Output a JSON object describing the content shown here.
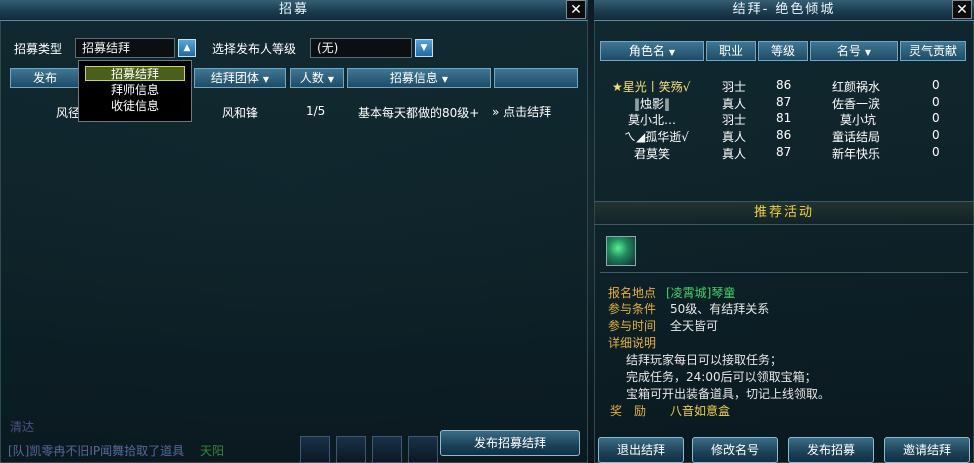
{
  "left": {
    "title": "招募",
    "close_label": "✕",
    "recruit_type_label": "招募类型",
    "recruit_type_value": "招募结拜",
    "level_label": "选择发布人等级",
    "level_value": "(无)",
    "dropdown_items": [
      "招募结拜",
      "拜师信息",
      "收徒信息"
    ],
    "headers": [
      "发布",
      "结拜团体",
      "人数",
      "招募信息",
      ""
    ],
    "row": {
      "publisher": "风径",
      "group": "风和锋",
      "count": "1/5",
      "info": "基本每天都做的80级+",
      "action": "点击结拜"
    },
    "publish_button": "发布招募结拜",
    "bg_chat": [
      "[队]凯零冉不旧IP闻舞拾取了道具",
      "清达",
      "天阳"
    ]
  },
  "right": {
    "title": "结拜- 绝色倾城",
    "close_label": "✕",
    "headers": [
      "角色名",
      "职业",
      "等级",
      "名号",
      "灵气贡献"
    ],
    "members": [
      {
        "name": "★星光丨笑殇√",
        "job": "羽士",
        "level": "86",
        "title": "红颜祸水",
        "contrib": "0"
      },
      {
        "name": "‖烛影‖",
        "job": "真人",
        "level": "87",
        "title": "佐香一涙",
        "contrib": "0"
      },
      {
        "name": "莫小北…",
        "job": "羽士",
        "level": "81",
        "title": "莫小坑",
        "contrib": "0"
      },
      {
        "name": "ㄟ◢孤华逝√",
        "job": "真人",
        "level": "86",
        "title": "童话结局",
        "contrib": "0"
      },
      {
        "name": "君莫笑",
        "job": "真人",
        "level": "87",
        "title": "新年快乐",
        "contrib": "0"
      }
    ],
    "activity_title": "推荐活动",
    "details": {
      "location_label": "报名地点",
      "location_value": "[凌霄城]琴童",
      "condition_label": "参与条件",
      "condition_value": "50级、有结拜关系",
      "time_label": "参与时间",
      "time_value": "全天皆可",
      "desc_label": "详细说明",
      "desc_lines": [
        "结拜玩家每日可以接取任务；",
        "完成任务，24:00后可以领取宝箱；",
        "宝箱可开出装备道具，切记上线领取。"
      ],
      "reward_label": "奖　励",
      "reward_value": "八音如意盒"
    },
    "buttons": [
      "退出结拜",
      "修改名号",
      "发布招募",
      "邀请结拜"
    ]
  },
  "colors": {
    "accent_orange": "#e6b13a",
    "accent_yellow": "#f0d24a",
    "accent_green": "#3fd36a",
    "header_blue": "#2a5f7c"
  }
}
